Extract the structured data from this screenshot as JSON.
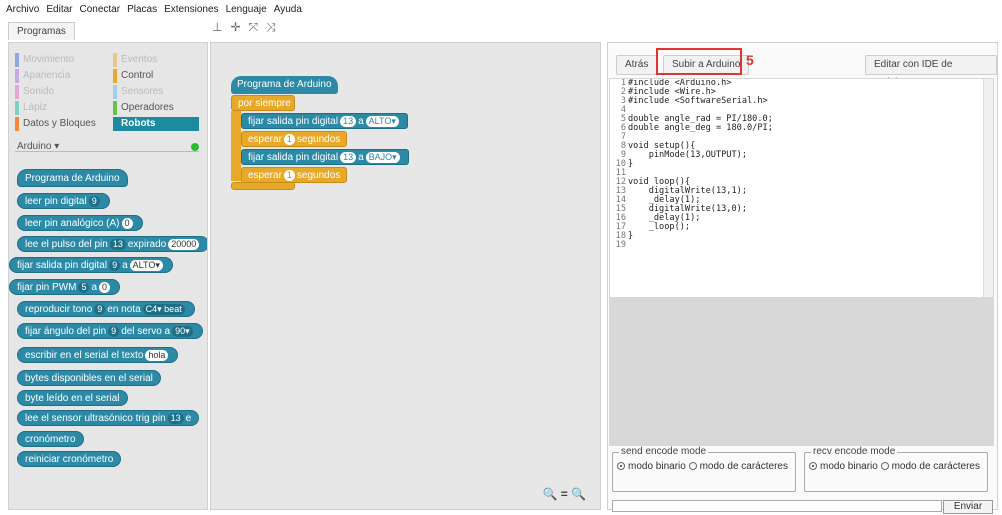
{
  "menu": [
    "Archivo",
    "Editar",
    "Conectar",
    "Placas",
    "Extensiones",
    "Lenguaje",
    "Ayuda"
  ],
  "toolbar_icons": [
    "stamp-icon",
    "plus-icon",
    "expand-icon",
    "shrink-icon"
  ],
  "palette": {
    "tab_label": "Programas",
    "categories_left": [
      "Movimiento",
      "Apariencia",
      "Sonido",
      "Lápiz",
      "Datos y Bloques"
    ],
    "categories_right": [
      "Eventos",
      "Control",
      "Sensores",
      "Operadores",
      "Robots"
    ],
    "header": "Arduino ▾",
    "blocks": [
      {
        "t1": "Programa de Arduino",
        "s": "",
        "t2": "",
        "s2": "",
        "hat": true
      },
      {
        "t1": "leer pin digital",
        "s": "9",
        "t2": "",
        "s2": ""
      },
      {
        "t1": "leer pin analógico (A)",
        "s": "0",
        "t2": "",
        "s2": ""
      },
      {
        "t1": "lee el pulso del pin",
        "s": "13",
        "t2": "expirado",
        "s2": "20000"
      },
      {
        "t1": "fijar salida pin digital",
        "s": "9",
        "t2": "a",
        "s2": "ALTO▾"
      },
      {
        "t1": "fijar pin PWM",
        "s": "5",
        "t2": "a",
        "s2": "0"
      },
      {
        "t1": "reproducir tono",
        "s": "9",
        "t2": "en nota",
        "s2": "C4▾ beat"
      },
      {
        "t1": "fijar ángulo del pin",
        "s": "9",
        "t2": "del servo a",
        "s2": "90▾"
      },
      {
        "t1": "escribir en el serial el texto",
        "s": "hola",
        "t2": "",
        "s2": ""
      },
      {
        "t1": "bytes disponibles en el serial",
        "s": "",
        "t2": "",
        "s2": ""
      },
      {
        "t1": "byte leído en el serial",
        "s": "",
        "t2": "",
        "s2": ""
      },
      {
        "t1": "lee el sensor ultrasónico trig pin",
        "s": "13",
        "t2": "e",
        "s2": ""
      },
      {
        "t1": "cronómetro",
        "s": "",
        "t2": "",
        "s2": ""
      },
      {
        "t1": "reiniciar cronómetro",
        "s": "",
        "t2": "",
        "s2": ""
      }
    ]
  },
  "script": {
    "hat": "Programa de Arduino",
    "loop": "por siempre",
    "set1": {
      "t": "fijar salida pin digital",
      "pin": "13",
      "a": "a",
      "val": "ALTO▾"
    },
    "wait1": {
      "t1": "esperar",
      "n": "1",
      "t2": "segundos"
    },
    "set2": {
      "t": "fijar salida pin digital",
      "pin": "13",
      "a": "a",
      "val": "BAJO▾"
    },
    "wait2": {
      "t1": "esperar",
      "n": "1",
      "t2": "segundos"
    },
    "zoom": "🔍 = 🔍"
  },
  "right": {
    "back": "Atrás",
    "upload": "Subir a Arduino",
    "step": "5",
    "edit_ide": "Editar con IDE de Arduino",
    "code": [
      "#include <Arduino.h>",
      "#include <Wire.h>",
      "#include <SoftwareSerial.h>",
      "",
      "double angle_rad = PI/180.0;",
      "double angle_deg = 180.0/PI;",
      "",
      "void setup(){",
      "    pinMode(13,OUTPUT);",
      "}",
      "",
      "void loop(){",
      "    digitalWrite(13,1);",
      "    _delay(1);",
      "    digitalWrite(13,0);",
      "    _delay(1);",
      "    _loop();",
      "}",
      ""
    ],
    "send": {
      "legend": "send encode mode",
      "opt1": "modo binario",
      "opt2": "modo de carácteres"
    },
    "recv": {
      "legend": "recv encode mode",
      "opt1": "modo binario",
      "opt2": "modo de carácteres"
    },
    "send_button": "Enviar"
  },
  "colors": {
    "accent": "#2c8aa6",
    "control": "#e8a92b",
    "highlight": "#e23333",
    "status_ok": "#2ebc2e"
  }
}
